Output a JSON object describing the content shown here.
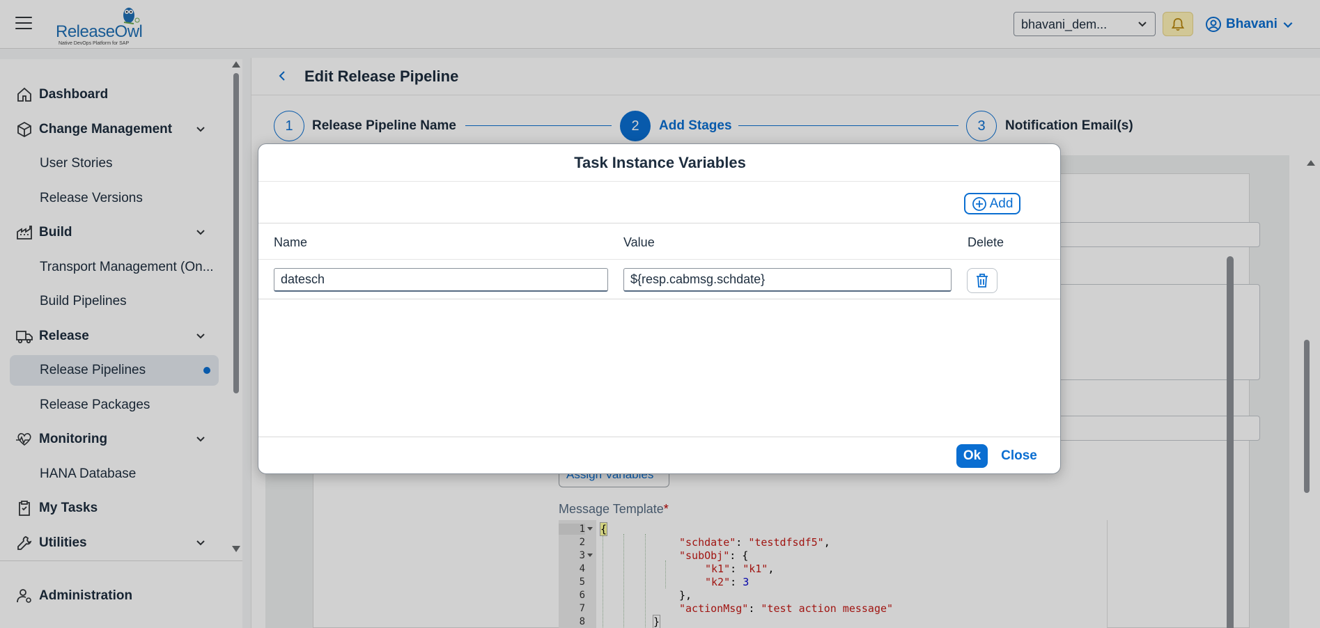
{
  "header": {
    "logo_text": "ReleaseOwl",
    "logo_tagline": "Native DevOps Platform for SAP",
    "tenant": "bhavani_dem...",
    "user": "Bhavani"
  },
  "sidebar": {
    "items": [
      {
        "label": "Dashboard",
        "icon": "home-icon"
      },
      {
        "label": "Change Management",
        "icon": "cube-icon"
      },
      {
        "label": "User Stories"
      },
      {
        "label": "Release Versions"
      },
      {
        "label": "Build",
        "icon": "factory-icon"
      },
      {
        "label": "Transport Management (On..."
      },
      {
        "label": "Build Pipelines"
      },
      {
        "label": "Release",
        "icon": "truck-icon"
      },
      {
        "label": "Release Pipelines"
      },
      {
        "label": "Release Packages"
      },
      {
        "label": "Monitoring",
        "icon": "heartbeat-icon"
      },
      {
        "label": "HANA Database"
      },
      {
        "label": "My Tasks",
        "icon": "clipboard-icon"
      },
      {
        "label": "Utilities",
        "icon": "wrench-icon"
      }
    ],
    "administration": "Administration"
  },
  "page": {
    "title": "Edit Release Pipeline",
    "steps": [
      {
        "number": "1",
        "label": "Release Pipeline Name"
      },
      {
        "number": "2",
        "label": "Add Stages"
      },
      {
        "number": "3",
        "label": "Notification Email(s)"
      }
    ],
    "assign_variables": "Assign Variables",
    "message_template_label": "Message Template",
    "code_lines": [
      {
        "n": "1"
      },
      {
        "n": "2"
      },
      {
        "n": "3"
      },
      {
        "n": "4"
      },
      {
        "n": "5"
      },
      {
        "n": "6"
      },
      {
        "n": "7"
      },
      {
        "n": "8"
      }
    ],
    "code": {
      "l2_key": "\"schdate\"",
      "l2_val": "\"testdfsdf5\"",
      "l3_key": "\"subObj\"",
      "l4_key": "\"k1\"",
      "l4_val": "\"k1\"",
      "l5_key": "\"k2\"",
      "l5_val": "3",
      "l7_key": "\"actionMsg\"",
      "l7_val": "\"test action message\""
    }
  },
  "dialog": {
    "title": "Task Instance Variables",
    "add_label": "Add",
    "columns": [
      "Name",
      "Value",
      "Delete"
    ],
    "rows": [
      {
        "name": "datesch",
        "value": "${resp.cabmsg.schdate}"
      }
    ],
    "ok_label": "Ok",
    "close_label": "Close"
  },
  "colors": {
    "accent": "#0a6ed1",
    "bell_bg": "#fff3b8"
  }
}
